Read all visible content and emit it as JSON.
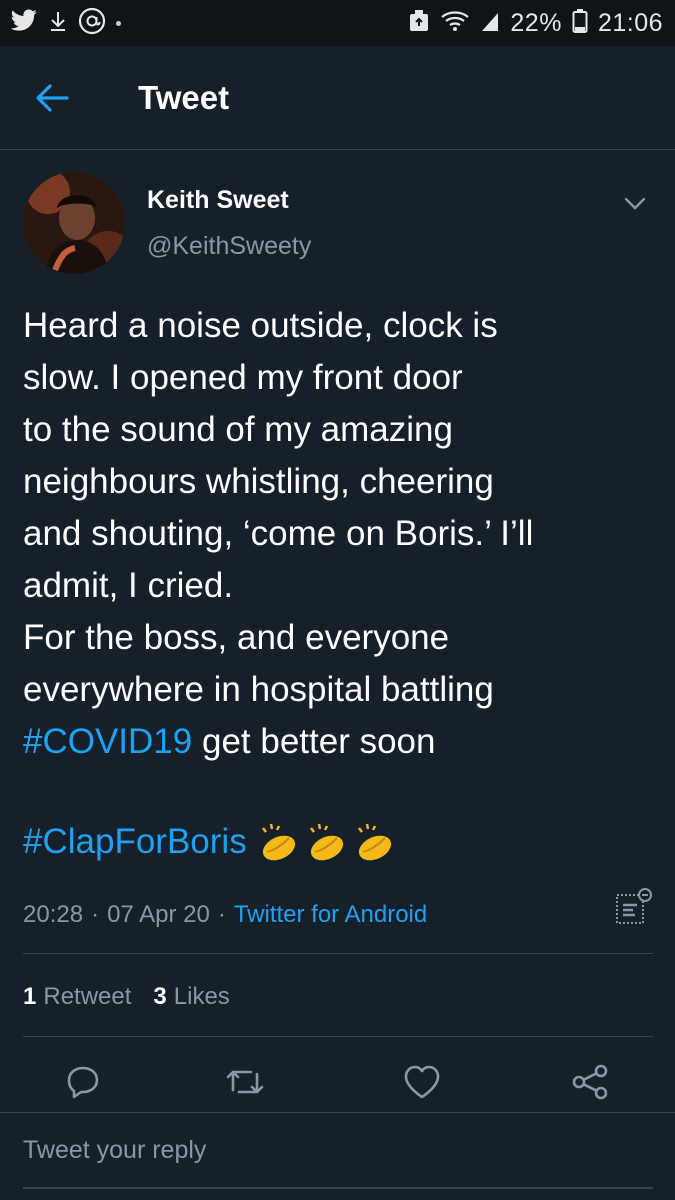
{
  "status_bar": {
    "battery": "22%",
    "time": "21:06",
    "left_icons": [
      "twitter-icon",
      "download-icon",
      "at-icon"
    ],
    "right_icons": [
      "recycle-icon",
      "wifi-icon",
      "signal-icon",
      "battery-icon"
    ]
  },
  "header": {
    "title": "Tweet"
  },
  "tweet": {
    "author_name": "Keith Sweet",
    "author_handle": "@KeithSweety",
    "text_lines": [
      "Heard a noise outside, clock is",
      "slow. I opened my front door",
      "to the sound of my amazing",
      "neighbours whistling, cheering",
      "and shouting, ‘come on Boris.’ I’ll",
      "admit, I cried.",
      "For the boss, and everyone",
      "everywhere in hospital battling"
    ],
    "hashtag_covid": "#COVID19",
    "covid_suffix": " get better soon",
    "hashtag_clap": "#ClapForBoris",
    "time": "20:28",
    "date": "07 Apr 20",
    "source": "Twitter for Android",
    "separator": "·"
  },
  "stats": {
    "retweets_count": "1",
    "retweets_label": "Retweet",
    "likes_count": "3",
    "likes_label": "Likes"
  },
  "reply": {
    "placeholder": "Tweet your reply"
  },
  "colors": {
    "background": "#15202b",
    "accent": "#1da1f2",
    "secondary_text": "#8899a6",
    "border": "#38444d"
  }
}
